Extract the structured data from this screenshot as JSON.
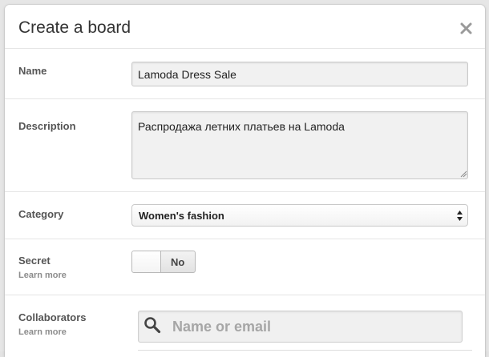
{
  "dialog": {
    "title": "Create a board",
    "close_icon": "close-icon"
  },
  "form": {
    "name": {
      "label": "Name",
      "value": "Lamoda Dress Sale"
    },
    "description": {
      "label": "Description",
      "value": "Распродажа летних платьев на Lamoda"
    },
    "category": {
      "label": "Category",
      "selected": "Women's fashion"
    },
    "secret": {
      "label": "Secret",
      "learn_more": "Learn more",
      "toggle_text": "No",
      "enabled": false
    },
    "collaborators": {
      "label": "Collaborators",
      "learn_more": "Learn more",
      "placeholder": "Name or email",
      "search_icon": "search-icon"
    }
  },
  "colors": {
    "modal_bg": "#ffffff",
    "backdrop": "#e6e6e6",
    "label_text": "#555555",
    "sublabel_text": "#8c8c8c",
    "input_bg": "#f1f1f1"
  }
}
